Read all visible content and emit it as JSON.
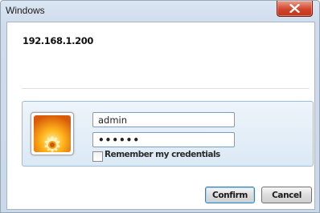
{
  "window": {
    "title": "Windows"
  },
  "dialog": {
    "host": "192.168.1.200",
    "username_value": "admin",
    "password_value": "••••••",
    "remember_label": "Remember my credentials",
    "remember_checked": false
  },
  "buttons": {
    "confirm_label": "Confirm",
    "cancel_label": "Cancel"
  },
  "icons": {
    "close": "close-icon",
    "user_tile": "user-tile-flower-icon"
  },
  "colors": {
    "close_button": "#d1462b",
    "panel_border": "#9bbdd8"
  }
}
